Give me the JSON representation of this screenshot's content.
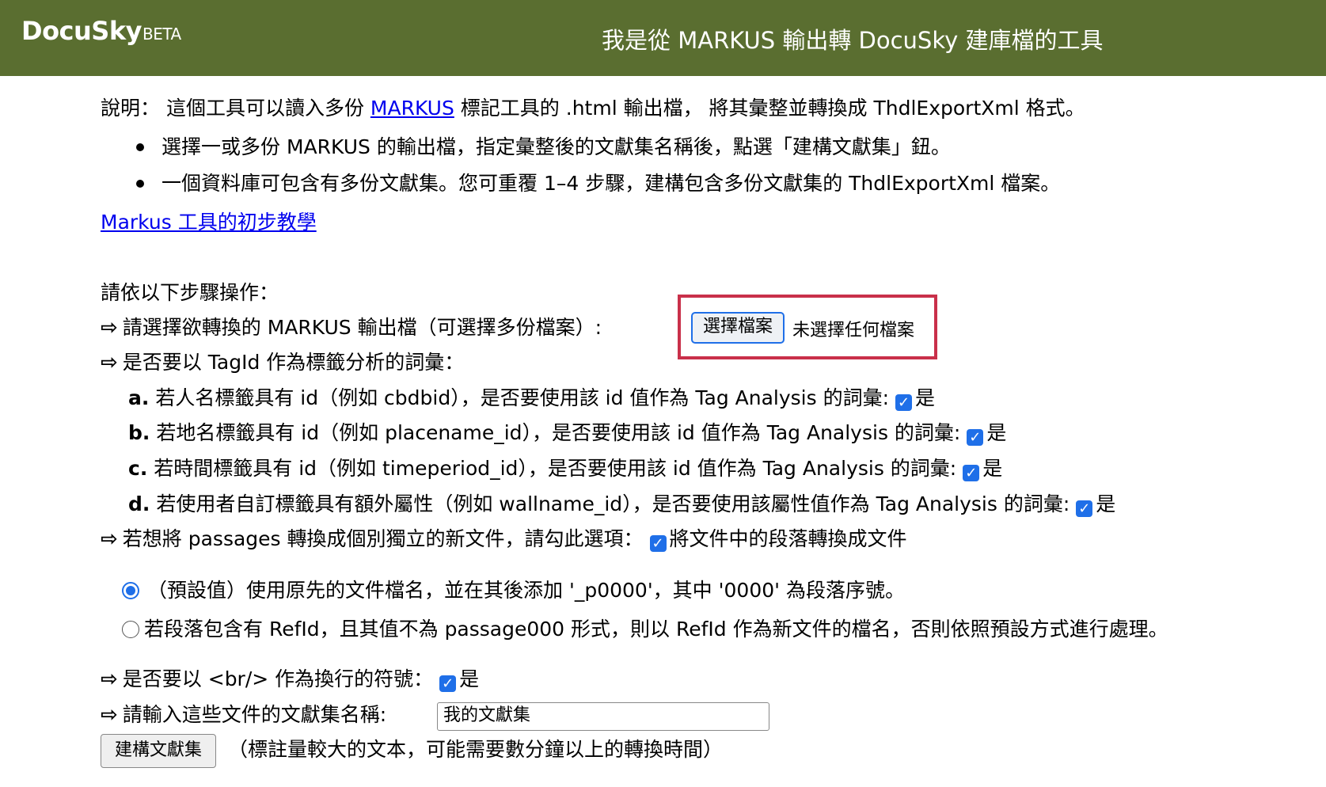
{
  "header": {
    "brand": "DocuSky",
    "brand_suffix": "BETA",
    "title": "我是從 MARKUS 輸出轉 DocuSky 建庫檔的工具"
  },
  "intro": {
    "prefix": "說明： 這個工具可以讀入多份",
    "link": "MARKUS",
    "suffix": "標記工具的 .html 輸出檔， 將其彙整並轉換成 ThdlExportXml 格式。",
    "bullets": [
      "選擇一或多份 MARKUS 的輸出檔，指定彙整後的文獻集名稱後，點選「建構文獻集」鈕。",
      "一個資料庫可包含有多份文獻集。您可重覆 1–4 步驟，建構包含多份文獻集的 ThdlExportXml 檔案。"
    ],
    "tutorial_link": "Markus 工具的初步教學"
  },
  "steps": {
    "heading": "請依以下步驟操作：",
    "arrow": "⇨",
    "select_files_label": "請選擇欲轉換的 MARKUS 輸出檔（可選擇多份檔案）:",
    "file_button": "選擇檔案",
    "no_file_text": "未選擇任何檔案",
    "tagid_question": "是否要以 TagId 作為標籤分析的詞彙：",
    "options": [
      {
        "letter": "a.",
        "text": "若人名標籤具有 id（例如 cbdbid），是否要使用該 id 值作為 Tag Analysis 的詞彙:",
        "checked": true,
        "check_label": "是"
      },
      {
        "letter": "b.",
        "text": "若地名標籤具有 id（例如 placename_id），是否要使用該 id 值作為 Tag Analysis 的詞彙:",
        "checked": true,
        "check_label": "是"
      },
      {
        "letter": "c.",
        "text": "若時間標籤具有 id（例如 timeperiod_id），是否要使用該 id 值作為 Tag Analysis 的詞彙:",
        "checked": true,
        "check_label": "是"
      },
      {
        "letter": "d.",
        "text": "若使用者自訂標籤具有額外屬性（例如 wallname_id），是否要使用該屬性值作為 Tag Analysis 的詞彙:",
        "checked": true,
        "check_label": "是"
      }
    ],
    "passages_label": "若想將 passages 轉換成個別獨立的新文件，請勾此選項：",
    "passages_check_label": "將文件中的段落轉換成文件",
    "radio_default": "（預設值）使用原先的文件檔名，並在其後添加 '_p0000'，其中 '0000' 為段落序號。",
    "radio_refid": "若段落包含有 RefId，且其值不為 passage000 形式，則以 RefId 作為新文件的檔名，否則依照預設方式進行處理。",
    "br_question": "是否要以 <br/> 作為換行的符號：",
    "br_check_label": "是",
    "collection_label": "請輸入這些文件的文獻集名稱:",
    "collection_value": "我的文獻集",
    "build_button": "建構文獻集",
    "build_note": "（標註量較大的文本，可能需要數分鐘以上的轉換時間）"
  },
  "colors": {
    "header_bg": "#5a6e30",
    "link": "#0000ee",
    "checkbox": "#1f6fe8",
    "highlight_box": "#c9304a"
  }
}
